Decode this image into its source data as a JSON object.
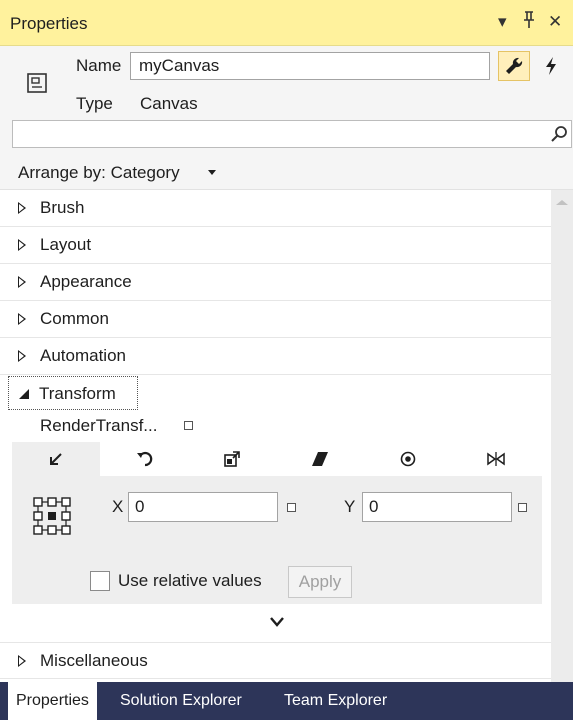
{
  "window": {
    "title": "Properties",
    "dropdown_glyph": "▾",
    "pin_glyph": "≱",
    "close_glyph": "✕"
  },
  "header": {
    "name_label": "Name",
    "name_value": "myCanvas",
    "type_label": "Type",
    "type_value": "Canvas",
    "search_placeholder": "",
    "icons": [
      "canvas-object-icon",
      "wrench-icon",
      "lightning-icon",
      "search-icon"
    ]
  },
  "arrange": {
    "label": "Arrange by: Category"
  },
  "categories": [
    {
      "label": "Brush"
    },
    {
      "label": "Layout"
    },
    {
      "label": "Appearance"
    },
    {
      "label": "Common"
    },
    {
      "label": "Automation"
    }
  ],
  "transform": {
    "label": "Transform",
    "render_transform_label": "RenderTransf...",
    "tabs": [
      "translate-icon",
      "rotate-icon",
      "scale-icon",
      "skew-icon",
      "center-point-icon",
      "flip-icon"
    ],
    "active_tab": 0,
    "x_label": "X",
    "x_value": "0",
    "y_label": "Y",
    "y_value": "0",
    "relative_label": "Use relative values",
    "relative_checked": false,
    "apply_label": "Apply"
  },
  "misc": {
    "label": "Miscellaneous"
  },
  "footer_tabs": [
    {
      "label": "Properties",
      "active": true
    },
    {
      "label": "Solution Explorer",
      "active": false
    },
    {
      "label": "Team Explorer",
      "active": false
    }
  ],
  "colors": {
    "title_bar": "#fff29d",
    "footer_bar": "#2d3559",
    "wrench_active": "#ffefbb"
  }
}
